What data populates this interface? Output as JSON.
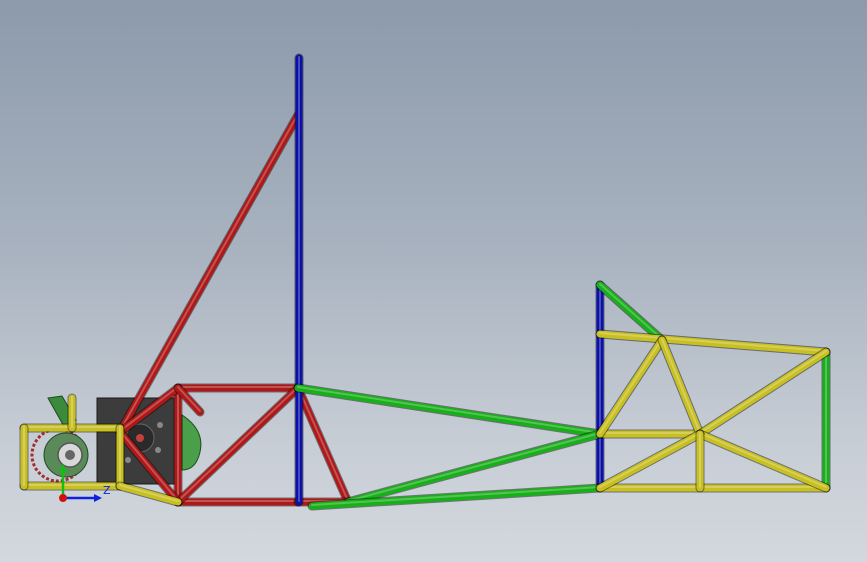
{
  "viewport": {
    "background_top": "#8c9aab",
    "background_bottom": "#d3d8de"
  },
  "model": {
    "name": "tube-frame-chassis",
    "colors": {
      "red": "#b01818",
      "blue": "#0a10a8",
      "green": "#18b018",
      "yellow": "#c8c020",
      "dark_part": "#3a3a3a"
    }
  },
  "triad": {
    "z_label": "Z",
    "x_color": "#d01010",
    "y_color": "#10c010",
    "z_color": "#1020e0"
  }
}
